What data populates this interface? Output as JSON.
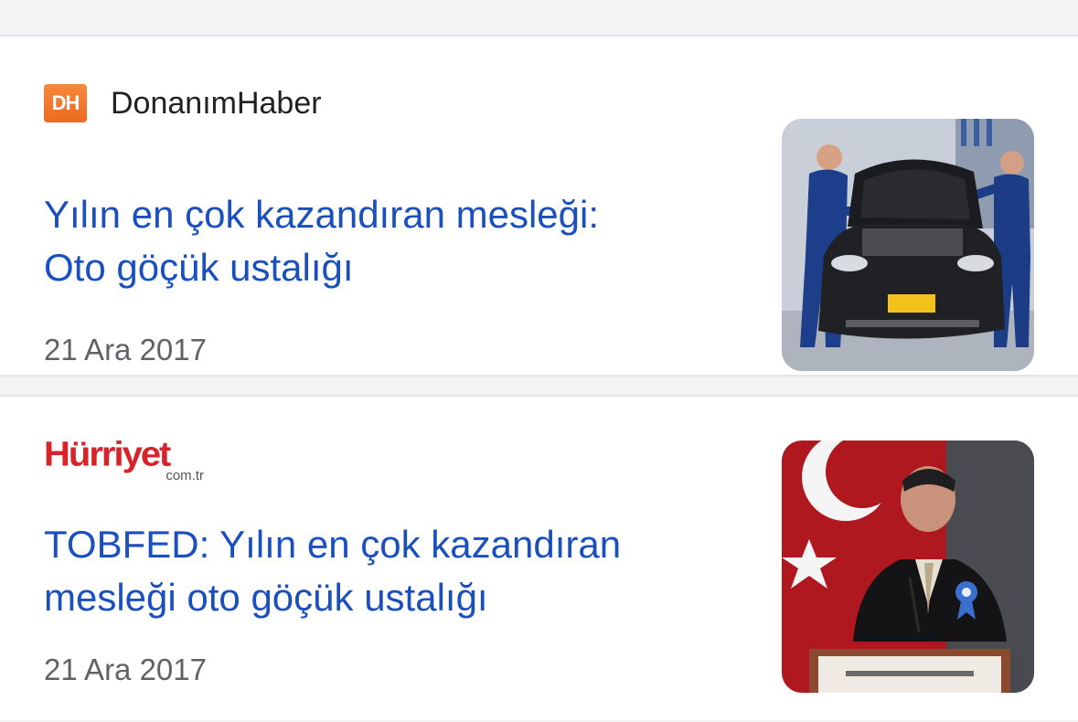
{
  "articles": [
    {
      "source": {
        "logo_text": "DH",
        "name": "DonanımHaber"
      },
      "headline_line1": "Yılın en çok kazandıran mesleği:",
      "headline_line2": "Oto göçük ustalığı",
      "date": "21 Ara 2017",
      "thumbnail": "mechanics-with-car-photo"
    },
    {
      "source": {
        "logo_text": "Hürriyet",
        "logo_sub": "com.tr"
      },
      "headline_line1": "TOBFED: Yılın en çok kazandıran",
      "headline_line2": "mesleği oto göçük ustalığı",
      "date": "21 Ara 2017",
      "thumbnail": "speaker-at-podium-photo"
    }
  ],
  "colors": {
    "headline": "#1a4fbf",
    "date": "#5f6368",
    "dh_orange": "#ec6a22",
    "hurriyet_red": "#d8232a",
    "background": "#f1f3f4"
  }
}
